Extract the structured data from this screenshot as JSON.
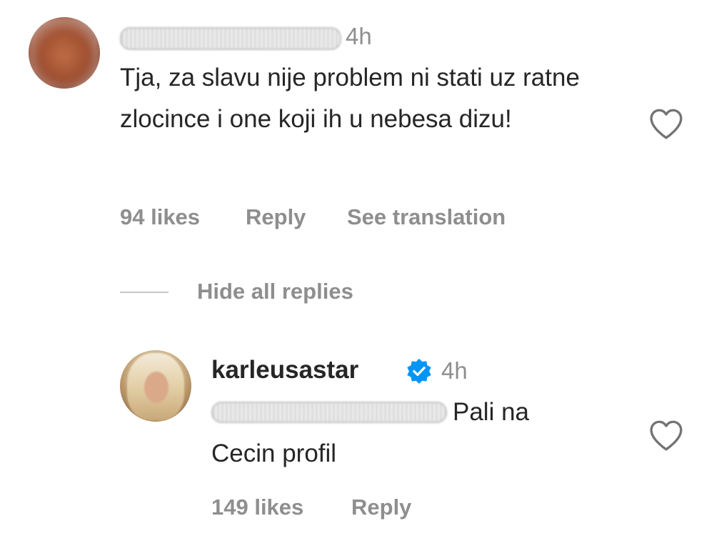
{
  "comment": {
    "time": "4h",
    "text": "Tja, za slavu nije problem ni stati uz ratne zlocince i one koji ih u nebesa dizu!",
    "likes": "94 likes",
    "reply_label": "Reply",
    "translate_label": "See translation",
    "icons": {
      "avatar": "avatar",
      "like": "heart-icon"
    }
  },
  "replies_toggle": {
    "label": "Hide all replies"
  },
  "reply": {
    "username": "karleusastar",
    "verified": true,
    "time": "4h",
    "text_after_mention": "Pali na",
    "text_line2": "Cecin profil",
    "likes": "149 likes",
    "reply_label": "Reply",
    "icons": {
      "verified": "verified-badge-icon",
      "like": "heart-icon"
    },
    "colors": {
      "verified": "#0095f6"
    }
  }
}
